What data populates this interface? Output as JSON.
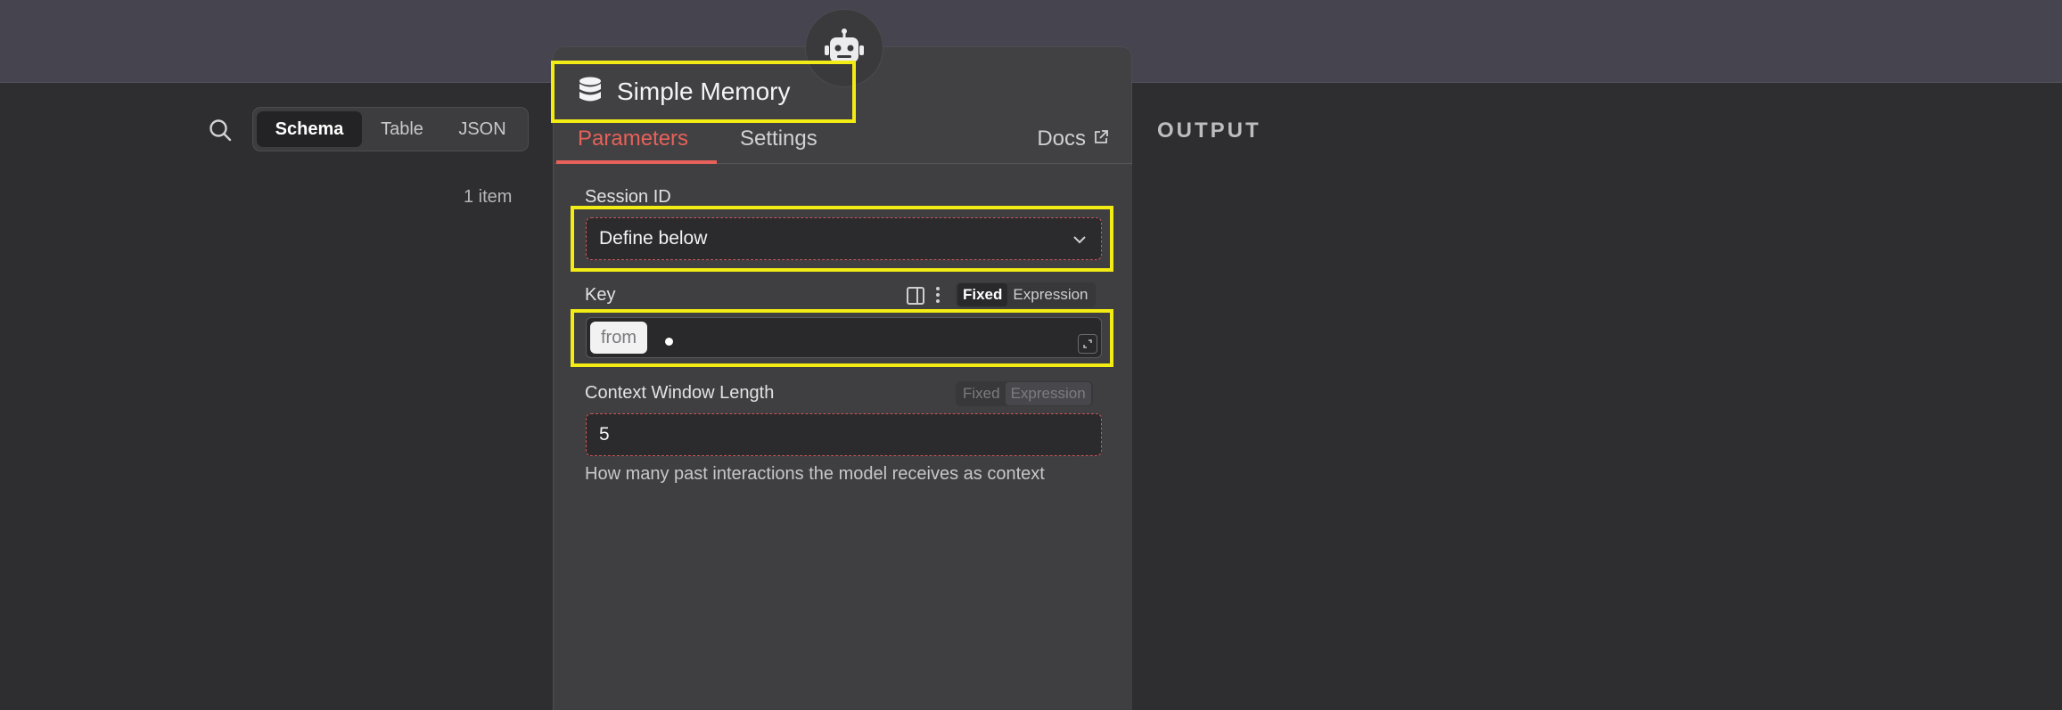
{
  "left_pane": {
    "view_options": [
      {
        "label": "Schema",
        "active": true
      },
      {
        "label": "Table",
        "active": false
      },
      {
        "label": "JSON",
        "active": false
      }
    ],
    "items_count": "1 item"
  },
  "output": {
    "label": "OUTPUT"
  },
  "node": {
    "title": "Simple Memory",
    "icon": "database-icon",
    "badge_icon": "robot-icon"
  },
  "tabs": {
    "parameters": "Parameters",
    "settings": "Settings",
    "docs": "Docs"
  },
  "fields": {
    "session_id": {
      "label": "Session ID",
      "value": "Define below"
    },
    "key": {
      "label": "Key",
      "modes": [
        "Fixed",
        "Expression"
      ],
      "selected_mode": "Fixed",
      "token": "from"
    },
    "context_window": {
      "label": "Context Window Length",
      "modes": [
        "Fixed",
        "Expression"
      ],
      "value": "5",
      "hint": "How many past interactions the model receives as context"
    }
  },
  "colors": {
    "accent": "#e7615a",
    "highlight": "#f2ec14",
    "topbar": "#46444f",
    "background": "#2e2e30",
    "panel": "#414143"
  }
}
